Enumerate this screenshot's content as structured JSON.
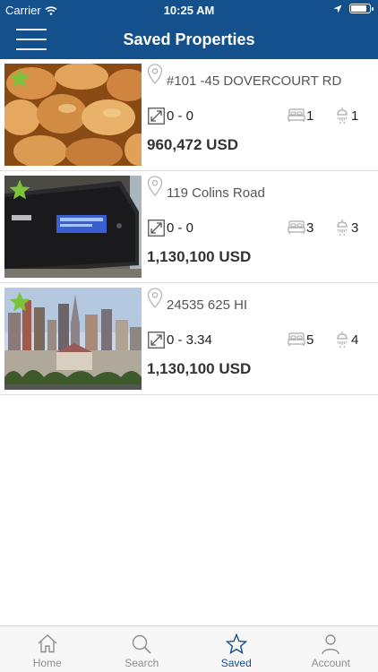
{
  "status_bar": {
    "carrier": "Carrier",
    "time": "10:25 AM",
    "battery_level": 0.95
  },
  "nav": {
    "title": "Saved Properties",
    "menu_icon": "hamburger-menu-icon"
  },
  "properties": [
    {
      "address": "#101 -45 DOVERCOURT RD",
      "size": "0 - 0",
      "beds": "1",
      "baths": "1",
      "price": "960,472 USD",
      "photo": "bread rolls",
      "favorite": true
    },
    {
      "address": "119 Colins Road",
      "size": "0 - 0",
      "beds": "3",
      "baths": "3",
      "price": "1,130,100 USD",
      "photo": "sony radio",
      "favorite": true
    },
    {
      "address": "24535 625 HI",
      "size": "0 - 3.34",
      "beds": "5",
      "baths": "4",
      "price": "1,130,100 USD",
      "photo": "las vegas skyline",
      "favorite": true
    }
  ],
  "tabs": [
    {
      "label": "Home",
      "icon": "home-icon",
      "active": false
    },
    {
      "label": "Search",
      "icon": "search-icon",
      "active": false
    },
    {
      "label": "Saved",
      "icon": "star-icon",
      "active": true
    },
    {
      "label": "Account",
      "icon": "person-icon",
      "active": false
    }
  ],
  "colors": {
    "primary": "#14508c",
    "favorite": "#7cc23a",
    "tab_inactive": "#8e8e93"
  }
}
